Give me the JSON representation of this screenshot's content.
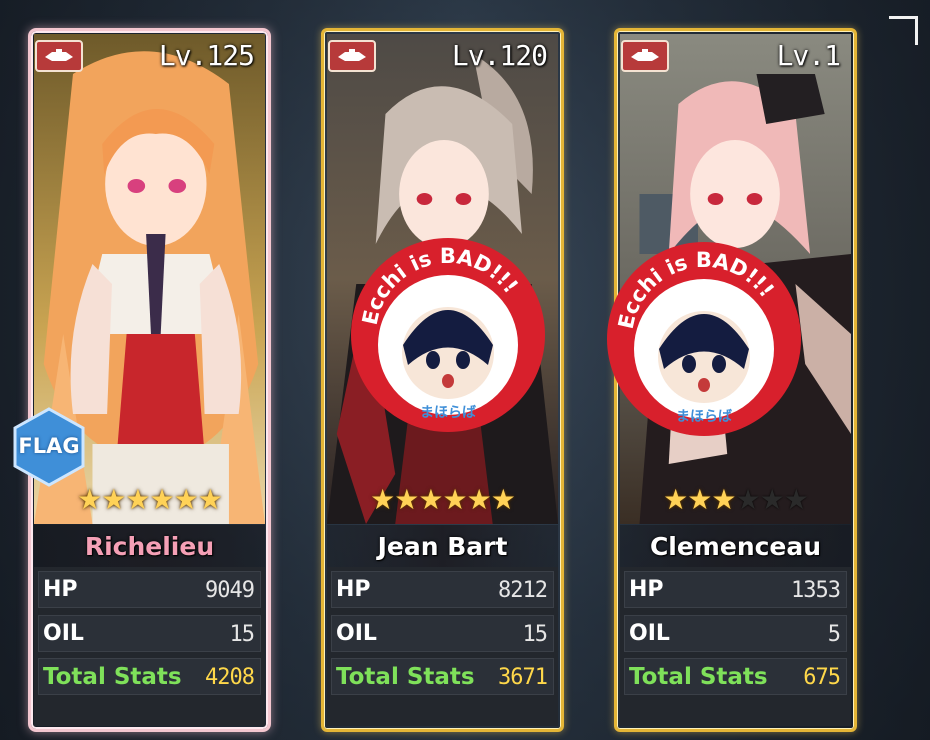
{
  "cards": [
    {
      "level": "Lv.125",
      "name": "Richelieu",
      "flag": "FLAG",
      "stars_filled": 6,
      "stars_total": 6,
      "stats": {
        "hp_label": "HP",
        "hp": "9049",
        "oil_label": "OIL",
        "oil": "15",
        "total_label": "Total Stats",
        "total": "4208"
      }
    },
    {
      "level": "Lv.120",
      "name": "Jean Bart",
      "stars_filled": 6,
      "stars_total": 6,
      "stats": {
        "hp_label": "HP",
        "hp": "8212",
        "oil_label": "OIL",
        "oil": "15",
        "total_label": "Total Stats",
        "total": "3671"
      },
      "sticker": {
        "text": "Ecchi is BAD!!!",
        "logo_text": "まほらば"
      }
    },
    {
      "level": "Lv.1",
      "name": "Clemenceau",
      "stars_filled": 3,
      "stars_total": 6,
      "stats": {
        "hp_label": "HP",
        "hp": "1353",
        "oil_label": "OIL",
        "oil": "5",
        "total_label": "Total Stats",
        "total": "675"
      },
      "sticker": {
        "text": "Ecchi is BAD!!!",
        "logo_text": "まほらば"
      }
    }
  ],
  "icons": {
    "type_badge": "ship-type-icon",
    "flag_badge": "flagship-hexagon-icon",
    "star": "star-icon",
    "corner": "corner-bracket-icon"
  },
  "colors": {
    "pink_frame": "#f3c6cf",
    "gold_frame": "#e4b536",
    "star": "#ffd257",
    "total_label": "#7fe15a",
    "total_value": "#ffd84a",
    "sticker_red": "#d8202c",
    "name_pink": "#f5a0b6"
  }
}
